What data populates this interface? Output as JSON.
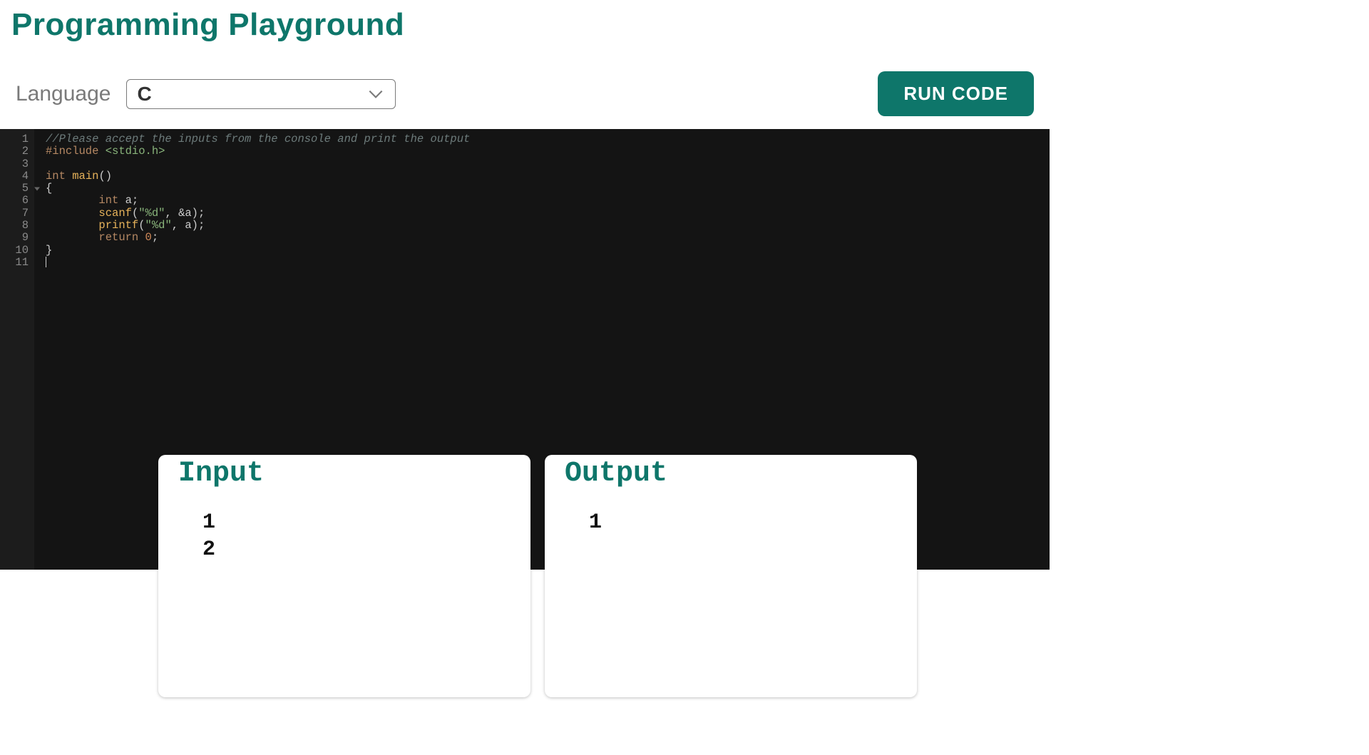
{
  "header": {
    "title": "Programming Playground"
  },
  "toolbar": {
    "language_label": "Language",
    "language_value": "C",
    "run_label": "RUN CODE"
  },
  "editor": {
    "line_numbers": [
      "1",
      "2",
      "3",
      "4",
      "5",
      "6",
      "7",
      "8",
      "9",
      "10",
      "11"
    ],
    "fold_line": 5,
    "code_lines": [
      {
        "tokens": [
          {
            "cls": "c-comment",
            "t": "//Please accept the inputs from the console and print the output"
          }
        ]
      },
      {
        "tokens": [
          {
            "cls": "c-pre",
            "t": "#include "
          },
          {
            "cls": "c-inc",
            "t": "<stdio.h>"
          }
        ]
      },
      {
        "tokens": []
      },
      {
        "tokens": [
          {
            "cls": "c-type",
            "t": "int"
          },
          {
            "cls": "c-punc",
            "t": " "
          },
          {
            "cls": "c-fn",
            "t": "main"
          },
          {
            "cls": "c-punc",
            "t": "()"
          }
        ]
      },
      {
        "tokens": [
          {
            "cls": "c-punc",
            "t": "{"
          }
        ]
      },
      {
        "tokens": [
          {
            "cls": "c-punc",
            "t": "        "
          },
          {
            "cls": "c-type",
            "t": "int"
          },
          {
            "cls": "c-punc",
            "t": " a;"
          }
        ]
      },
      {
        "tokens": [
          {
            "cls": "c-punc",
            "t": "        "
          },
          {
            "cls": "c-fn",
            "t": "scanf"
          },
          {
            "cls": "c-punc",
            "t": "("
          },
          {
            "cls": "c-str",
            "t": "\"%d\""
          },
          {
            "cls": "c-punc",
            "t": ", &a);"
          }
        ]
      },
      {
        "tokens": [
          {
            "cls": "c-punc",
            "t": "        "
          },
          {
            "cls": "c-fn",
            "t": "printf"
          },
          {
            "cls": "c-punc",
            "t": "("
          },
          {
            "cls": "c-str",
            "t": "\"%d\""
          },
          {
            "cls": "c-punc",
            "t": ", a);"
          }
        ]
      },
      {
        "tokens": [
          {
            "cls": "c-punc",
            "t": "        "
          },
          {
            "cls": "c-kw",
            "t": "return"
          },
          {
            "cls": "c-punc",
            "t": " "
          },
          {
            "cls": "c-num",
            "t": "0"
          },
          {
            "cls": "c-punc",
            "t": ";"
          }
        ]
      },
      {
        "tokens": [
          {
            "cls": "c-punc",
            "t": "}"
          }
        ]
      },
      {
        "tokens": [],
        "cursor": true
      }
    ]
  },
  "io": {
    "input_title": "Input",
    "input_body": "1\n2",
    "output_title": "Output",
    "output_body": "1"
  }
}
